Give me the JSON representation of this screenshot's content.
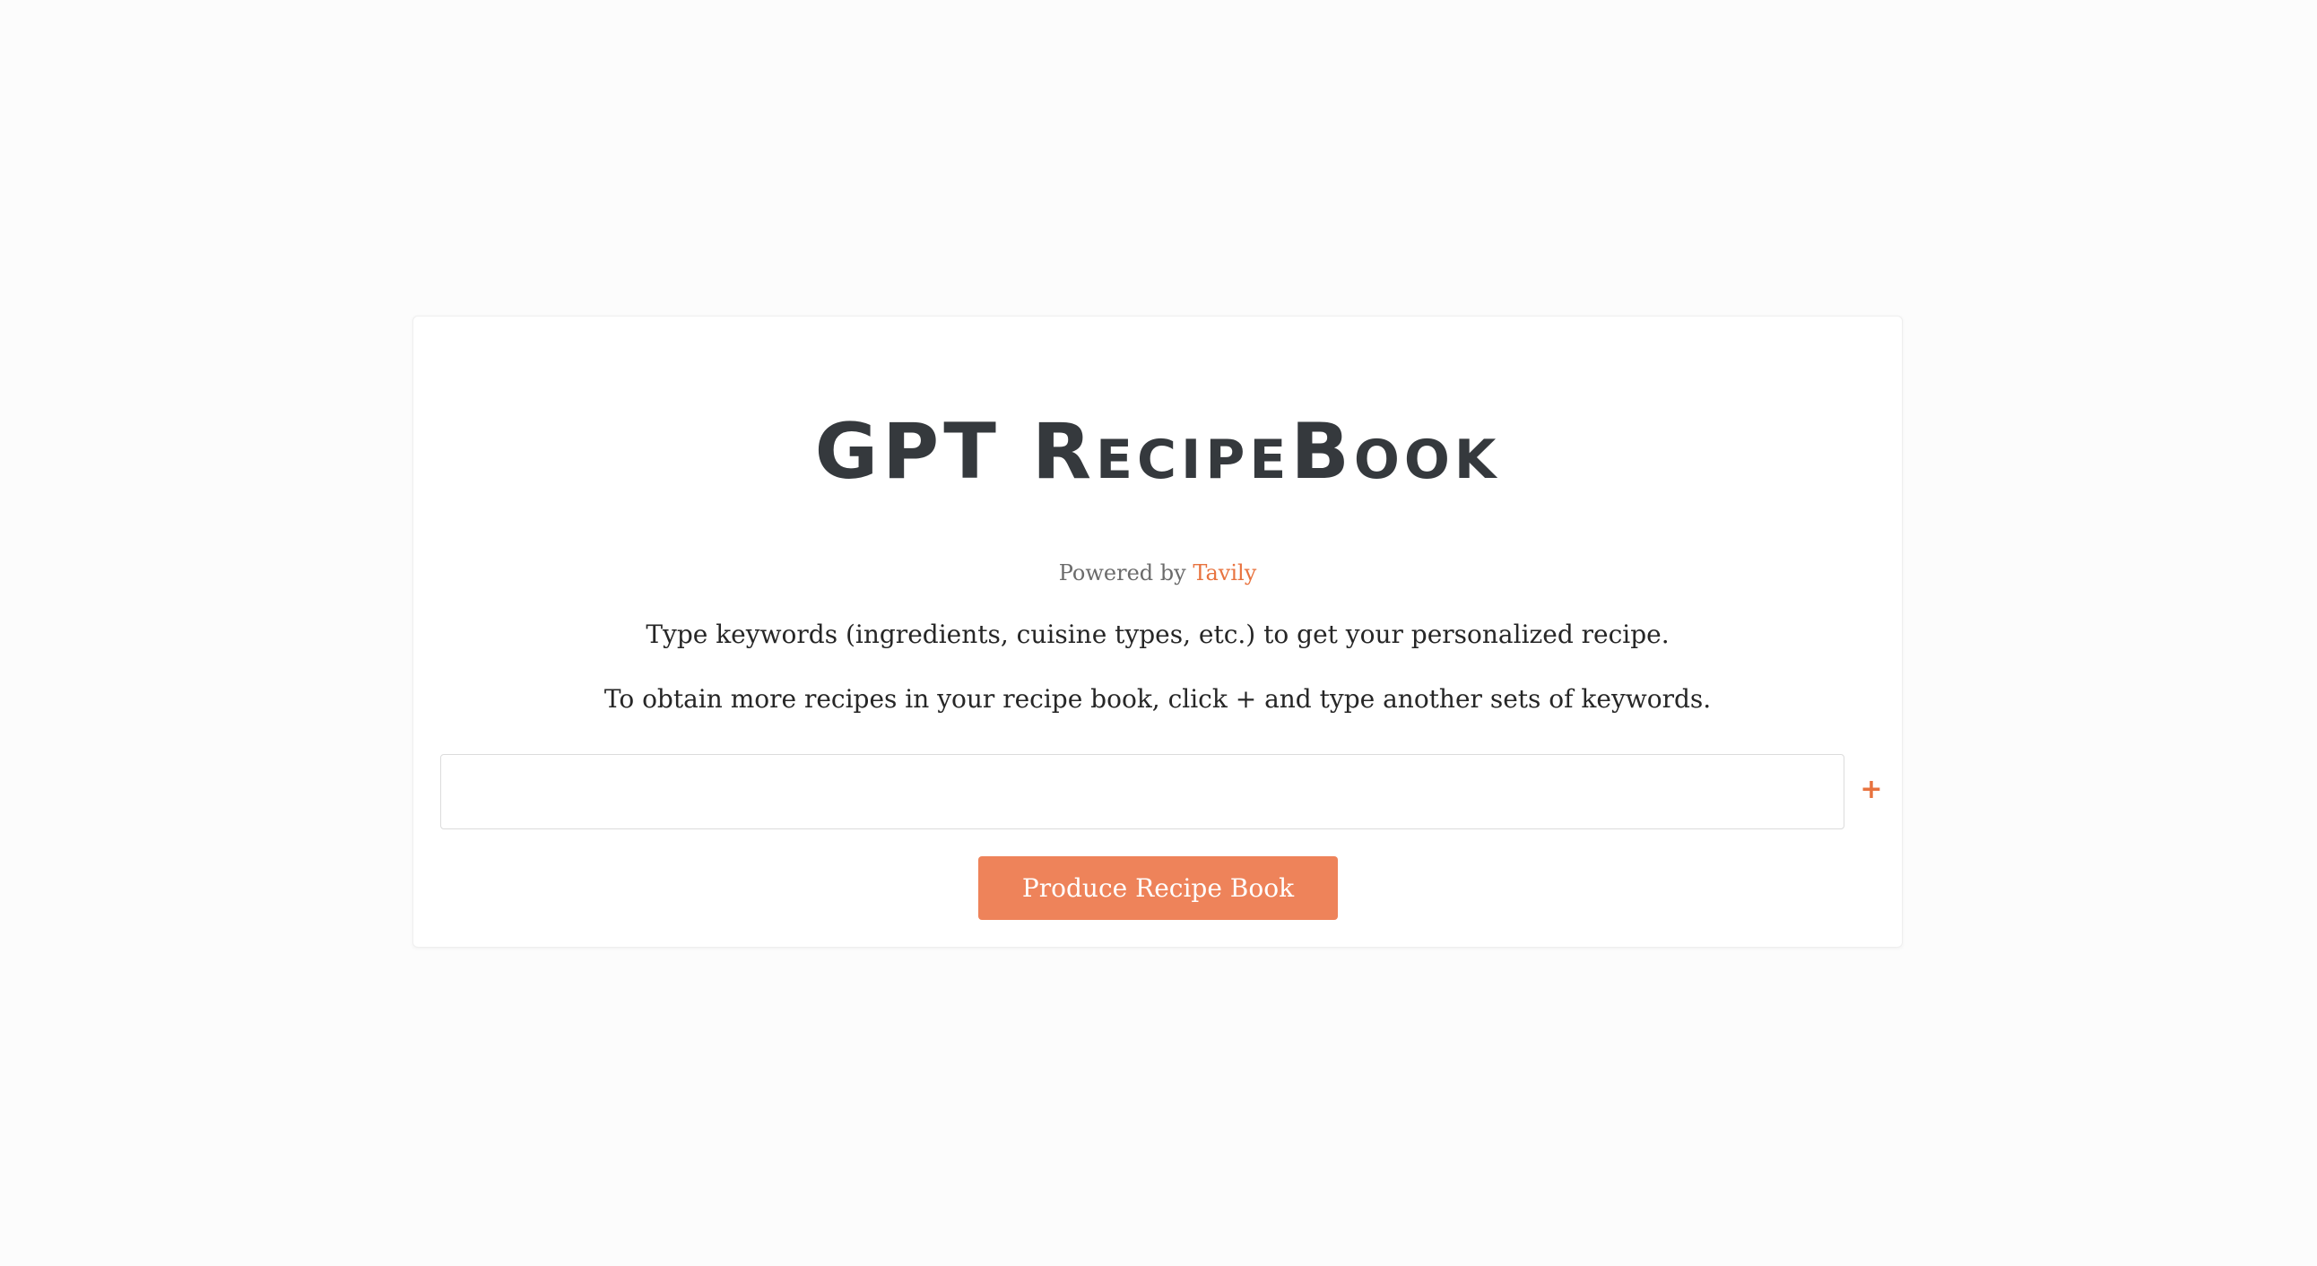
{
  "app": {
    "title": "GPT RecipeBook",
    "powered_by_prefix": "Powered by ",
    "powered_by_brand": "Tavily",
    "instruction_1": "Type keywords (ingredients, cuisine types, etc.) to get your personalized recipe.",
    "instruction_2": "To obtain more recipes in your recipe book, click + and type another sets of keywords."
  },
  "form": {
    "keywords_input": {
      "value": "",
      "placeholder": ""
    },
    "add_label": "+",
    "submit_label": "Produce Recipe Book"
  },
  "colors": {
    "accent": "#e8733f",
    "button_bg": "#ee835a",
    "title": "#35393d",
    "page_bg": "#fcfcfc"
  },
  "icons": {
    "add": "plus-icon"
  }
}
